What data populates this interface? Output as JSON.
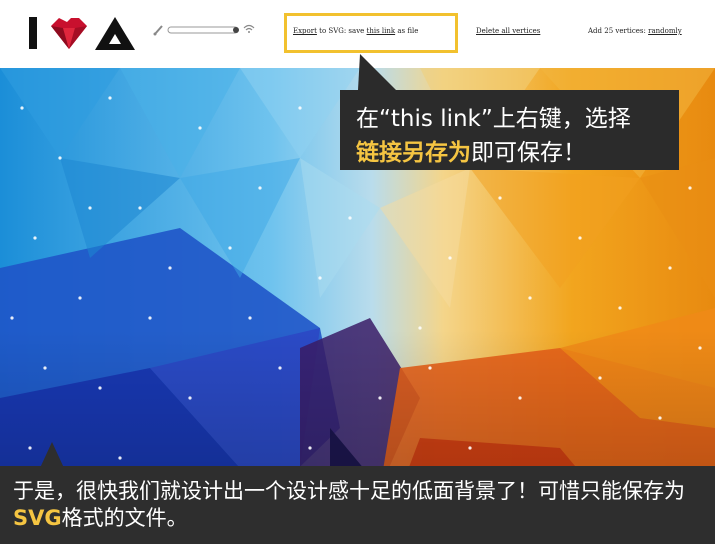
{
  "toolbar": {
    "export_link": "Export",
    "export_mid": " to SVG: save ",
    "this_link": "this link",
    "export_tail": " as file",
    "delete_label": "Delete all vertices",
    "add_prefix": "Add 25 vertices: ",
    "randomly_label": "randomly"
  },
  "callout_top": {
    "line1": "在“this link”上右键，选择",
    "highlight": "链接另存为",
    "line2_rest": "即可保存！"
  },
  "caption": {
    "part1": "于是，很快我们就设计出一个设计感十足的低面背景了！可惜只能保存为",
    "svg": "SVG",
    "part2": "格式的文件。"
  },
  "colors": {
    "accent": "#f5c542",
    "highlight_box": "#f2c12e",
    "dark_panel": "#2b2b2b",
    "logo_heart": "#c8102e"
  },
  "icons": {
    "logo": "i-heart-delta-logo",
    "brush": "brush-icon",
    "wifi": "signal-icon"
  }
}
